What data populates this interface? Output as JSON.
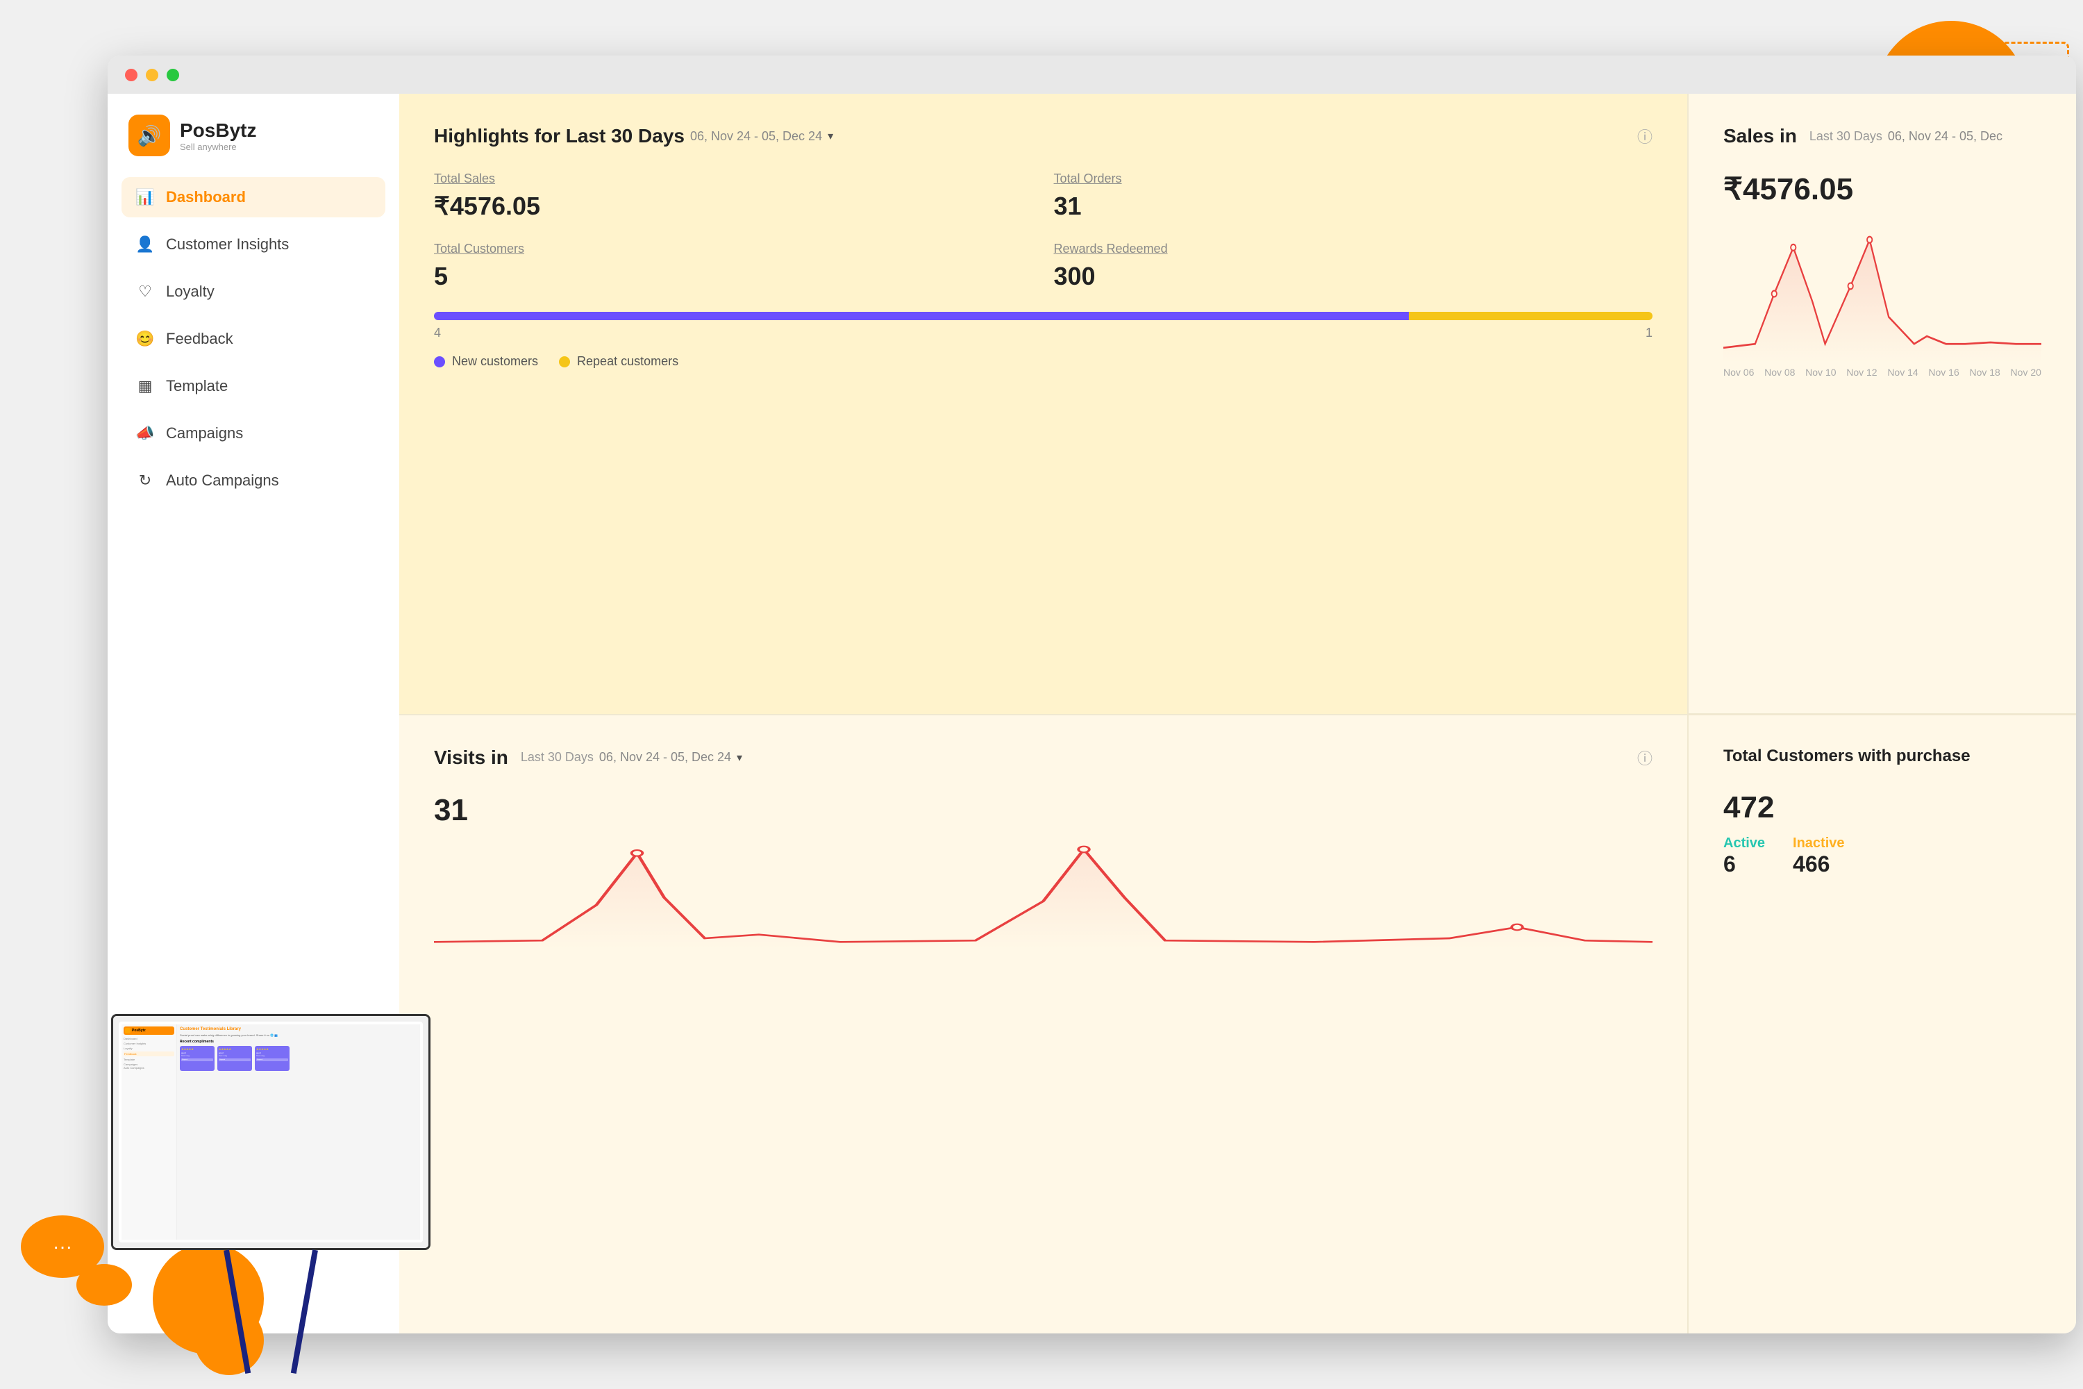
{
  "app": {
    "name": "PosBytz",
    "tagline": "Sell anywhere"
  },
  "browser": {
    "traffic_lights": [
      "red",
      "yellow",
      "green"
    ]
  },
  "sidebar": {
    "items": [
      {
        "id": "dashboard",
        "label": "Dashboard",
        "icon": "📊",
        "active": true
      },
      {
        "id": "customer-insights",
        "label": "Customer Insights",
        "icon": "👤",
        "active": false
      },
      {
        "id": "loyalty",
        "label": "Loyalty",
        "icon": "♡",
        "active": false
      },
      {
        "id": "feedback",
        "label": "Feedback",
        "icon": "😊",
        "active": false
      },
      {
        "id": "template",
        "label": "Template",
        "icon": "▦",
        "active": false
      },
      {
        "id": "campaigns",
        "label": "Campaigns",
        "icon": "📣",
        "active": false
      },
      {
        "id": "auto-campaigns",
        "label": "Auto Campaigns",
        "icon": "↻",
        "active": false
      }
    ]
  },
  "highlights": {
    "title": "Highlights for Last 30 Days",
    "date_range": "06, Nov 24 - 05, Dec 24",
    "total_sales_label": "Total Sales",
    "total_sales_value": "₹4576.05",
    "total_orders_label": "Total Orders",
    "total_orders_value": "31",
    "total_customers_label": "Total Customers",
    "total_customers_value": "5",
    "rewards_label": "Rewards Redeemed",
    "rewards_value": "300",
    "new_customers_count": "4",
    "repeat_customers_count": "1",
    "new_customers_legend": "New customers",
    "repeat_customers_legend": "Repeat customers"
  },
  "sales": {
    "title": "Sales in",
    "period": "Last 30 Days",
    "date_range": "06, Nov 24 - 05, Dec",
    "value": "₹4576.05",
    "x_labels": [
      "Nov 06",
      "Nov 08",
      "Nov 10",
      "Nov 12",
      "Nov 14",
      "Nov 16",
      "Nov 18",
      "Nov 20"
    ]
  },
  "visits": {
    "title": "Visits in",
    "period": "Last 30 Days",
    "date_range": "06, Nov 24 - 05, Dec 24",
    "value": "31"
  },
  "total_customers": {
    "title": "Total Customers with purchase",
    "value": "472",
    "active_label": "Active",
    "inactive_label": "Inactive",
    "active_count": "6",
    "inactive_count": "466"
  },
  "colors": {
    "orange": "#FF8C00",
    "purple": "#6B4EFF",
    "yellow_bar": "#F5C518",
    "active": "#26C6B0",
    "inactive": "#FFB020",
    "chart_line": "#E84040"
  }
}
